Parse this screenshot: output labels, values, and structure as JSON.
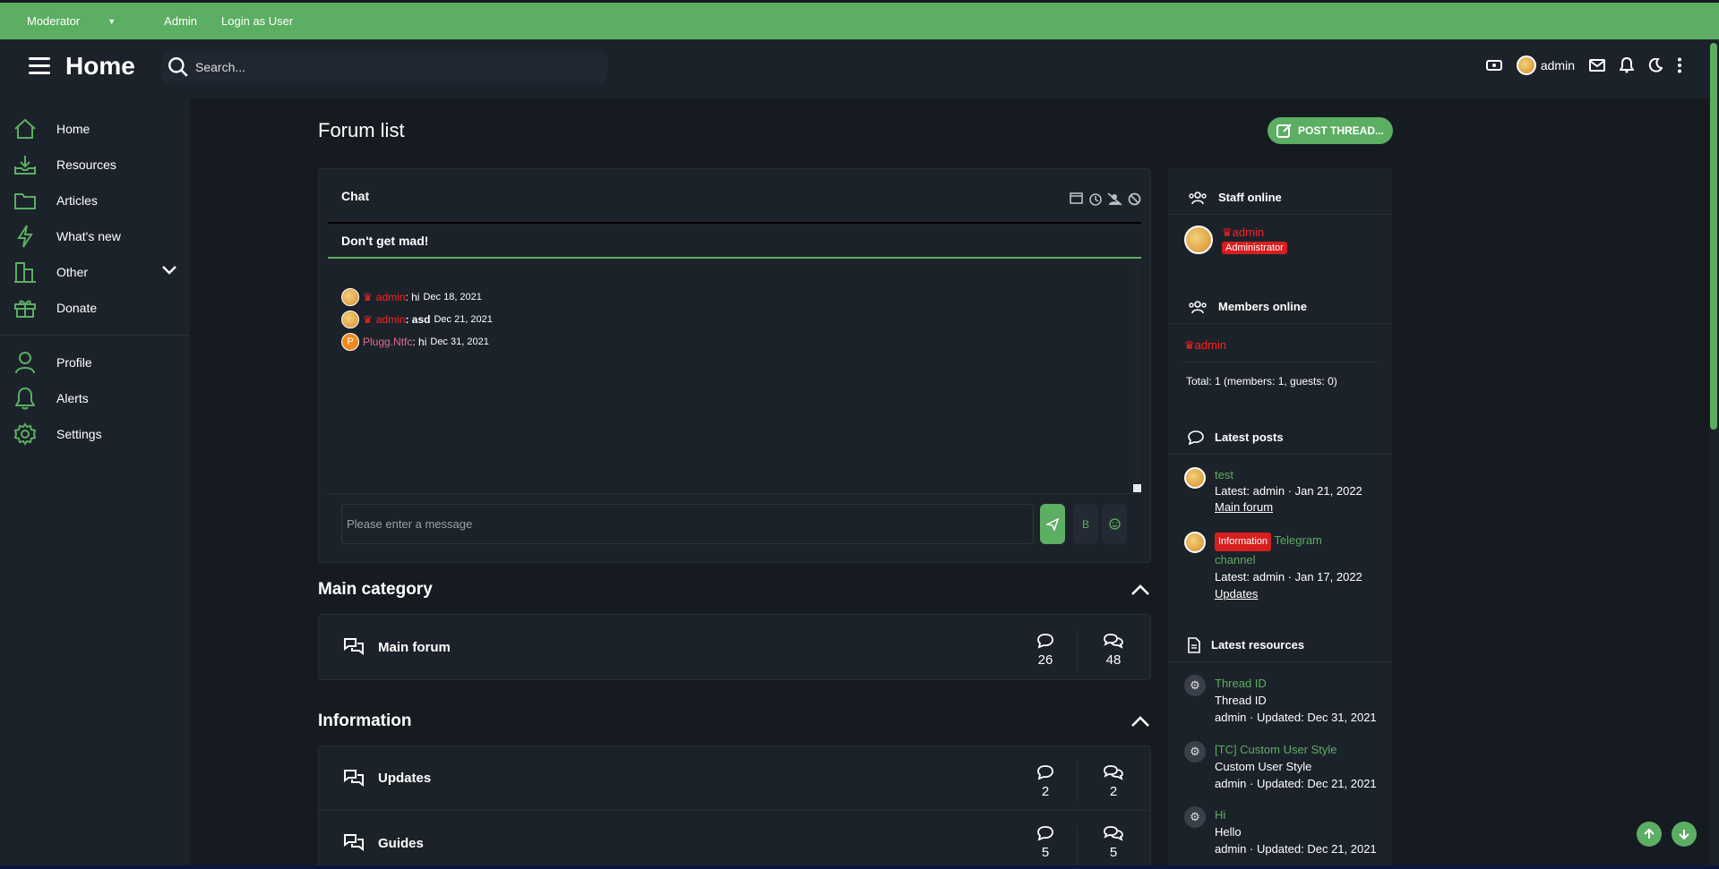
{
  "topbar": {
    "moderator_label": "Moderator",
    "admin_label": "Admin",
    "login_as_user_label": "Login as User"
  },
  "header": {
    "title": "Home",
    "search_placeholder": "Search...",
    "user_name": "admin"
  },
  "sidebar": {
    "items": [
      {
        "label": "Home",
        "icon": "home-icon"
      },
      {
        "label": "Resources",
        "icon": "download-icon"
      },
      {
        "label": "Articles",
        "icon": "folder-icon"
      },
      {
        "label": "What's new",
        "icon": "bolt-icon"
      },
      {
        "label": "Other",
        "icon": "building-icon"
      },
      {
        "label": "Donate",
        "icon": "gift-icon"
      },
      {
        "label": "Profile",
        "icon": "user-icon"
      },
      {
        "label": "Alerts",
        "icon": "bell-icon"
      },
      {
        "label": "Settings",
        "icon": "gear-icon"
      }
    ]
  },
  "page": {
    "title": "Forum list",
    "post_thread_label": "POST THREAD..."
  },
  "chat": {
    "title": "Chat",
    "notice": "Don't get mad!",
    "messages": [
      {
        "user": "admin",
        "text": ": hi",
        "time": "Dec 18, 2021"
      },
      {
        "user": "admin",
        "text": ": asd",
        "time": "Dec 21, 2021"
      },
      {
        "user": "Plugg.Ntfc",
        "text": ": hi",
        "time": "Dec 31, 2021",
        "avatar_letter": "P"
      }
    ],
    "input_placeholder": "Please enter a message",
    "bold_label": "B"
  },
  "categories": [
    {
      "title": "Main category",
      "forums": [
        {
          "name": "Main forum",
          "threads": "26",
          "messages": "48"
        }
      ]
    },
    {
      "title": "Information",
      "forums": [
        {
          "name": "Updates",
          "threads": "2",
          "messages": "2"
        },
        {
          "name": "Guides",
          "threads": "5",
          "messages": "5"
        }
      ]
    }
  ],
  "right_sidebar": {
    "staff_online": {
      "title": "Staff online",
      "user": "admin",
      "role": "Administrator"
    },
    "members_online": {
      "title": "Members online",
      "user": "admin",
      "total": "Total: 1 (members: 1, guests: 0)"
    },
    "latest_posts": {
      "title": "Latest posts",
      "posts": [
        {
          "title": "test",
          "meta": "Latest: admin · Jan 21, 2022",
          "forum": "Main forum"
        },
        {
          "prefix": "Information",
          "title_part1": "Telegram",
          "title_part2": "channel",
          "meta": "Latest: admin · Jan 17, 2022",
          "forum": "Updates"
        }
      ]
    },
    "latest_resources": {
      "title": "Latest resources",
      "items": [
        {
          "title": "Thread ID",
          "desc": "Thread ID",
          "meta": "admin · Updated: Dec 31, 2021"
        },
        {
          "title": "[TC] Custom User Style",
          "desc": "Custom User Style",
          "meta": "admin · Updated: Dec 21, 2021"
        },
        {
          "title": "Hi",
          "desc": "Hello",
          "meta": "admin · Updated: Dec 21, 2021"
        }
      ]
    }
  },
  "colors": {
    "accent": "#5cae62",
    "background": "#161b21",
    "panel": "#1c222a",
    "admin_red": "#ff2020"
  }
}
